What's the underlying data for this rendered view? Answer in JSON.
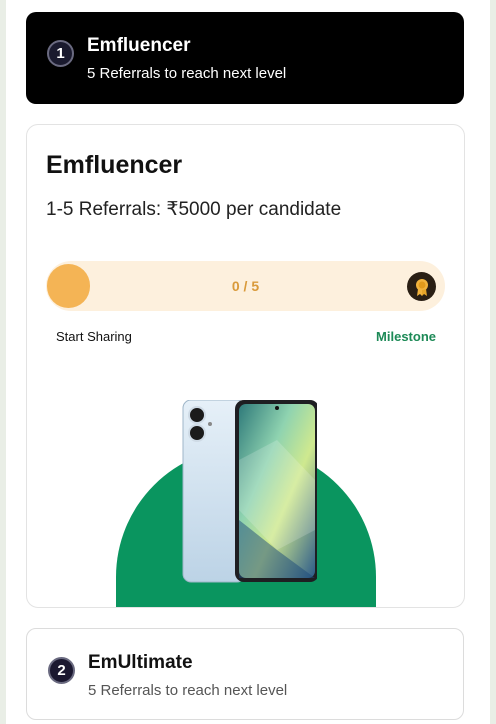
{
  "tiers": [
    {
      "number": "1",
      "title": "Emfluencer",
      "subtitle": "5 Referrals to reach next level"
    },
    {
      "number": "2",
      "title": "EmUltimate",
      "subtitle": "5 Referrals to reach next level"
    }
  ],
  "detail": {
    "title": "Emfluencer",
    "rate": "1-5 Referrals: ₹5000 per candidate",
    "progress": {
      "current": 0,
      "total": 5,
      "text": "0 / 5"
    },
    "start_label": "Start Sharing",
    "milestone_label": "Milestone"
  },
  "colors": {
    "progress_fill": "#f4b455",
    "progress_track": "#fdf0dd",
    "milestone": "#1d8a57",
    "arch": "#0a955f"
  },
  "icons": {
    "milestone_badge": "medal-icon",
    "reward": "phone-image"
  }
}
